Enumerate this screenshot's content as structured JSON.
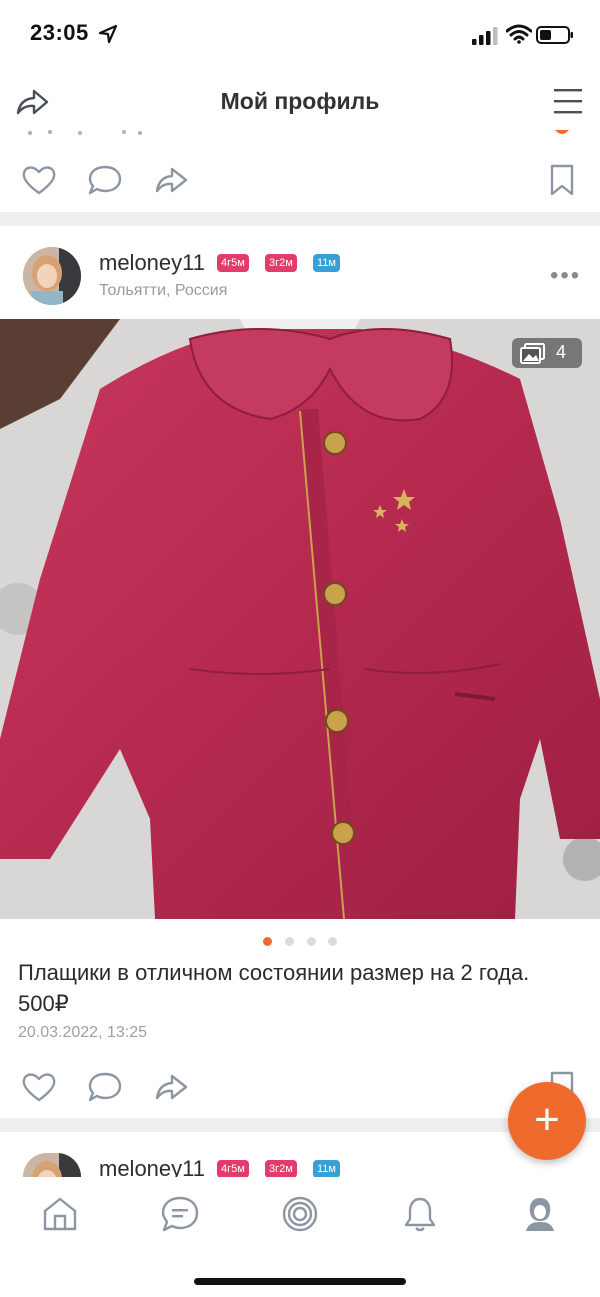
{
  "status_bar": {
    "time": "23:05"
  },
  "header": {
    "title": "Мой профиль"
  },
  "colors": {
    "accent": "#ef6a2d",
    "badge_pink": "#e23c6b",
    "badge_blue": "#3a9fd6",
    "icon_gray": "#8c96a3"
  },
  "posts": [
    {
      "username": "meloney11",
      "badges": [
        "4г5м",
        "3г2м",
        "11м"
      ],
      "location": "Тольятти, Россия",
      "more_label": "•••",
      "photo_count": "4",
      "text": "Плащики в отличном состоянии размер на 2 года. 500₽",
      "date": "20.03.2022, 13:25",
      "active_photo": 0,
      "photos_total": 4
    },
    {
      "username": "meloney11",
      "badges": [
        "4г5м",
        "3г2м",
        "11м"
      ]
    }
  ],
  "fab": {
    "label": "+"
  },
  "icons": {
    "share": "share-icon",
    "menu": "menu-icon",
    "like": "heart-icon",
    "comment": "comment-icon",
    "bookmark": "bookmark-icon",
    "home": "home-icon",
    "messages": "chat-icon",
    "feed": "target-icon",
    "notifications": "bell-icon",
    "profile": "profile-icon",
    "gallery": "gallery-icon"
  }
}
